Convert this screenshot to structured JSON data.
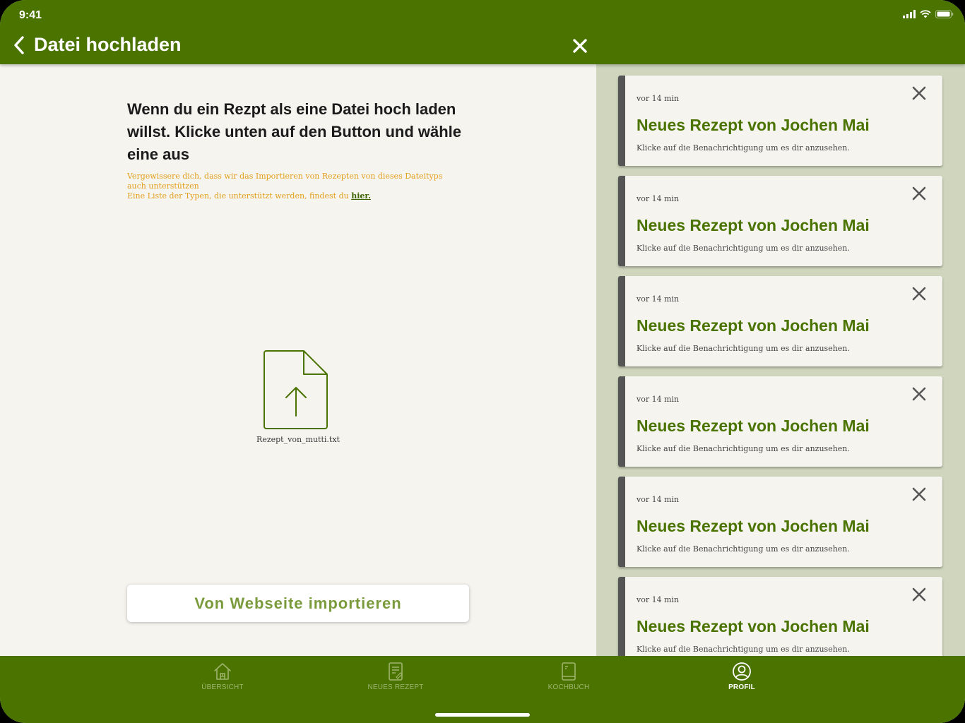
{
  "status_bar": {
    "time": "9:41"
  },
  "header": {
    "title": "Datei hochladen"
  },
  "main": {
    "heading": "Wenn du ein Rezpt als eine Datei hoch laden willst. Klicke unten auf den Button und wähle eine aus",
    "hint_line1": "Vergewissere dich, dass wir das Importieren von Rezepten von dieses Dateityps auch unterstützen",
    "hint_line2_prefix": "Eine Liste der Typen, die unterstützt werden, findest du ",
    "hint_link": "hier.",
    "file_name": "Rezept_von_mutti.txt",
    "import_button": "Von Webseite importieren"
  },
  "notifications": [
    {
      "time": "vor 14 min",
      "title": "Neues Rezept von Jochen Mai",
      "body": "Klicke auf die Benachrichtigung um es dir anzusehen."
    },
    {
      "time": "vor 14 min",
      "title": "Neues Rezept von Jochen Mai",
      "body": "Klicke auf die Benachrichtigung um es dir anzusehen."
    },
    {
      "time": "vor 14 min",
      "title": "Neues Rezept von Jochen Mai",
      "body": "Klicke auf die Benachrichtigung um es dir anzusehen."
    },
    {
      "time": "vor 14 min",
      "title": "Neues Rezept von Jochen Mai",
      "body": "Klicke auf die Benachrichtigung um es dir anzusehen."
    },
    {
      "time": "vor 14 min",
      "title": "Neues Rezept von Jochen Mai",
      "body": "Klicke auf die Benachrichtigung um es dir anzusehen."
    },
    {
      "time": "vor 14 min",
      "title": "Neues Rezept von Jochen Mai",
      "body": "Klicke auf die Benachrichtigung um es dir anzusehen."
    }
  ],
  "tabbar": {
    "tabs": [
      {
        "label": "ÜBERSICHT",
        "icon": "home-icon",
        "active": false
      },
      {
        "label": "NEUES REZEPT",
        "icon": "new-recipe-icon",
        "active": false
      },
      {
        "label": "KOCHBUCH",
        "icon": "cookbook-icon",
        "active": false
      },
      {
        "label": "PROFIL",
        "icon": "profile-icon",
        "active": true
      }
    ]
  },
  "colors": {
    "brand_green": "#4a7300",
    "accent_orange": "#e2a01e",
    "panel_bg": "#cfd6bd",
    "page_bg": "#f6f4ef"
  }
}
